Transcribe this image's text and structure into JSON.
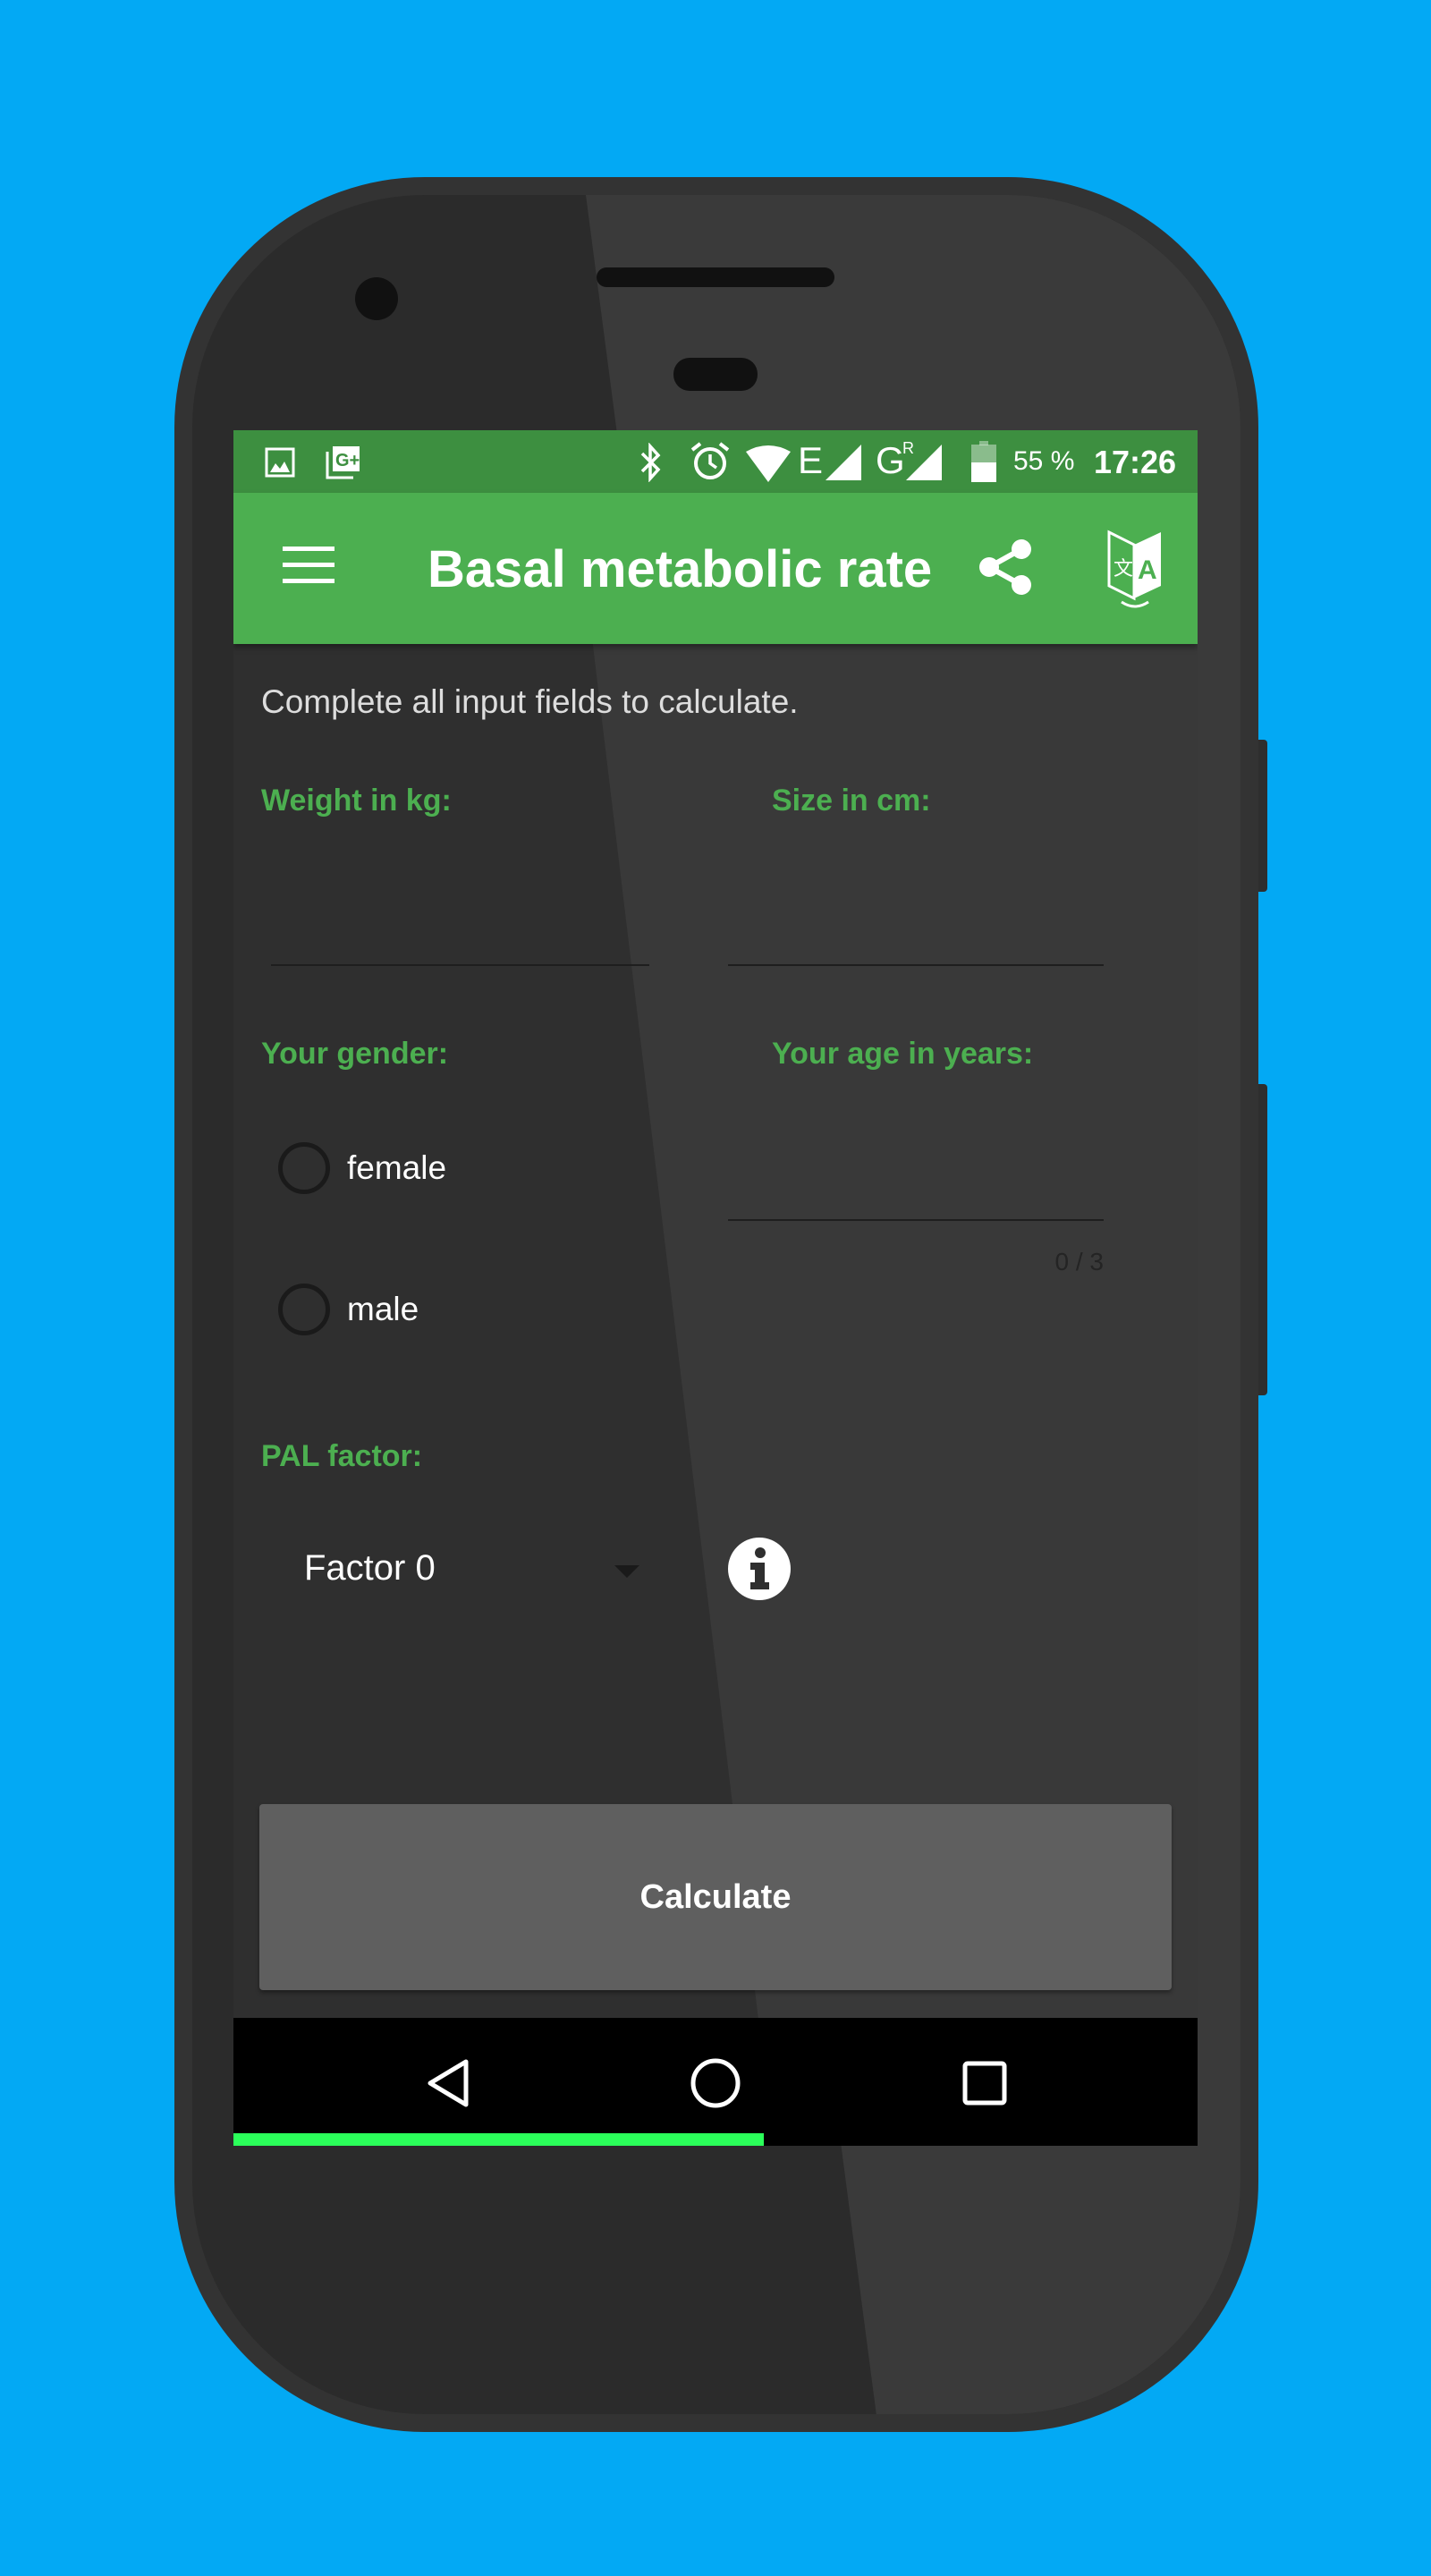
{
  "status_bar": {
    "left_icons": [
      "image-icon",
      "google-plus-icon"
    ],
    "right_icons": [
      "bluetooth-icon",
      "alarm-icon",
      "wifi-icon",
      "signal-e-icon",
      "signal-g-roaming-icon",
      "battery-icon"
    ],
    "network_e": "E",
    "network_g": "G",
    "roaming": "R",
    "battery": "55 %",
    "battery_level": 55,
    "time": "17:26"
  },
  "app_bar": {
    "menu_icon": "hamburger-menu-icon",
    "title": "Basal metabolic rate",
    "share_icon": "share-icon",
    "translate_icon": "translate-icon"
  },
  "form": {
    "instructions": "Complete all input fields to calculate.",
    "weight_label": "Weight in kg:",
    "weight_value": "",
    "size_label": "Size in cm:",
    "size_value": "",
    "gender_label": "Your gender:",
    "gender_options": [
      "female",
      "male"
    ],
    "age_label": "Your age in years:",
    "age_value": "",
    "age_counter": "0 / 3",
    "pal_label": "PAL factor:",
    "pal_selected": "Factor 0",
    "calculate_label": "Calculate"
  },
  "nav_bar": {
    "icons": [
      "back-icon",
      "home-icon",
      "recents-icon"
    ],
    "progress_percent": 55
  },
  "colors": {
    "background": "#03a9f4",
    "primary": "#4caf50",
    "primary_dark": "#3d8f40",
    "progress": "#2bff5a",
    "button": "#5f5f5f"
  }
}
